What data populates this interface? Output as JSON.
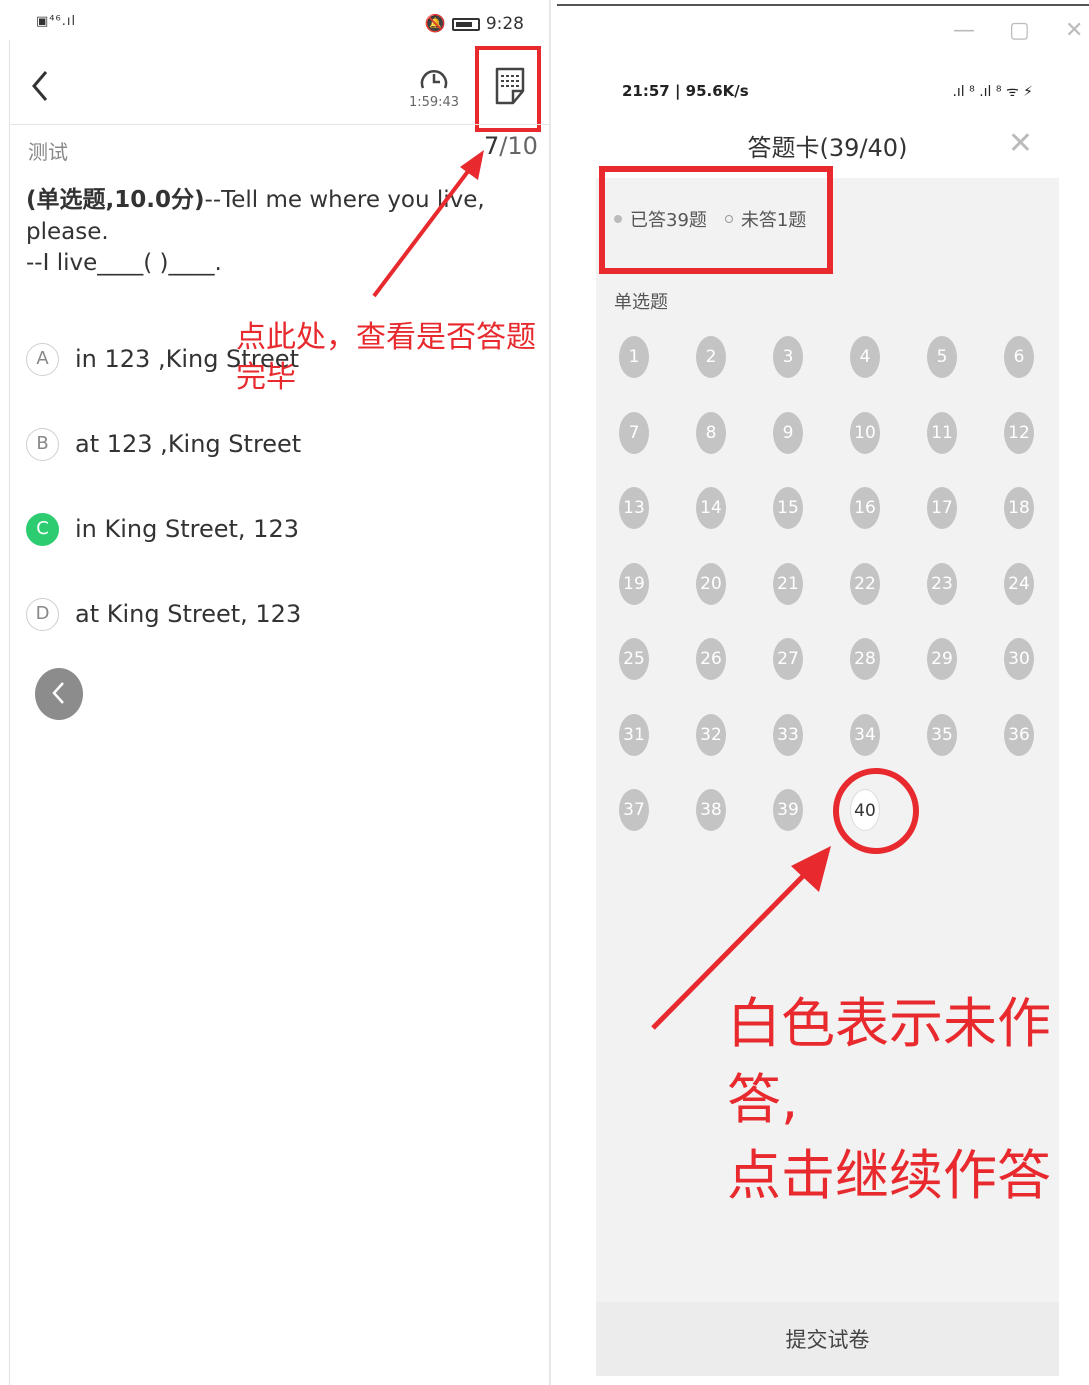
{
  "left_screen": {
    "status": {
      "left_icons": "▣⁴⁶.ıl ",
      "time": "9:28"
    },
    "toolbar": {
      "timer": "1:59:43"
    },
    "section_label": "测试",
    "progress": {
      "current": "7",
      "total": "/10"
    },
    "question": {
      "type_score": "(单选题,10.0分)",
      "text": "--Tell me where you live, please.",
      "line2": "--I live____( )____."
    },
    "options": [
      {
        "letter": "A",
        "text": "in 123 ,King Street",
        "selected": false
      },
      {
        "letter": "B",
        "text": "at 123 ,King Street",
        "selected": false
      },
      {
        "letter": "C",
        "text": "in King Street, 123",
        "selected": true
      },
      {
        "letter": "D",
        "text": "at King Street, 123",
        "selected": false
      }
    ],
    "annotation": "点此处，查看是否答题完毕"
  },
  "right_screen": {
    "status": {
      "left": "21:57 | 95.6K/s",
      "right": ".ıl ⁸ .ıl ⁸ ᯤ ⚡"
    },
    "title": "答题卡(39/40)",
    "legend": {
      "answered": "已答39题",
      "unanswered": "未答1题"
    },
    "category": "单选题",
    "questions": [
      1,
      2,
      3,
      4,
      5,
      6,
      7,
      8,
      9,
      10,
      11,
      12,
      13,
      14,
      15,
      16,
      17,
      18,
      19,
      20,
      21,
      22,
      23,
      24,
      25,
      26,
      27,
      28,
      29,
      30,
      31,
      32,
      33,
      34,
      35,
      36,
      37,
      38,
      39,
      40
    ],
    "unanswered_question": 40,
    "submit_label": "提交试卷",
    "annotation_line1": "白色表示未作答,",
    "annotation_line2": "点击继续作答"
  },
  "colors": {
    "accent_red": "#e8292d",
    "selected_green": "#2ecc71",
    "answered_grey": "#c4c4c4"
  }
}
